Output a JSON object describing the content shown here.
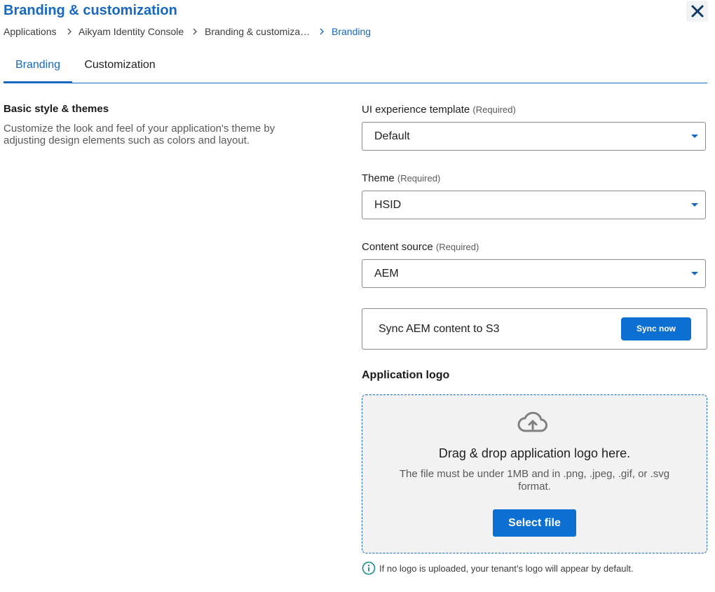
{
  "header": {
    "title": "Branding & customization",
    "close_icon": "close-icon"
  },
  "breadcrumb": {
    "items": [
      "Applications",
      "Aikyam Identity Console",
      "Branding & customiza…",
      "Branding"
    ],
    "separator_icon": "chevron-right-icon"
  },
  "tabs": [
    {
      "label": "Branding",
      "active": true
    },
    {
      "label": "Customization",
      "active": false
    }
  ],
  "section": {
    "heading": "Basic style & themes",
    "description": "Customize the look and feel of your application's theme by adjusting design elements such as colors and layout."
  },
  "fields": {
    "template": {
      "label": "UI experience template",
      "required": "(Required)",
      "value": "Default"
    },
    "theme": {
      "label": "Theme",
      "required": "(Required)",
      "value": "HSID"
    },
    "content_source": {
      "label": "Content source",
      "required": "(Required)",
      "value": "AEM"
    }
  },
  "sync": {
    "text": "Sync AEM content to S3",
    "button_label": "Sync now"
  },
  "logo": {
    "heading": "Application logo",
    "upload_icon": "cloud-upload-icon",
    "drop_title": "Drag & drop application logo here.",
    "drop_desc": "The file must be under 1MB and in .png, .jpeg, .gif, or .svg format.",
    "button_label": "Select file"
  },
  "info": {
    "icon": "info-icon",
    "text": "If no logo is uploaded, your tenant’s logo will appear by default."
  },
  "colors": {
    "accent": "#1868bf",
    "button": "#0c6fd2"
  }
}
